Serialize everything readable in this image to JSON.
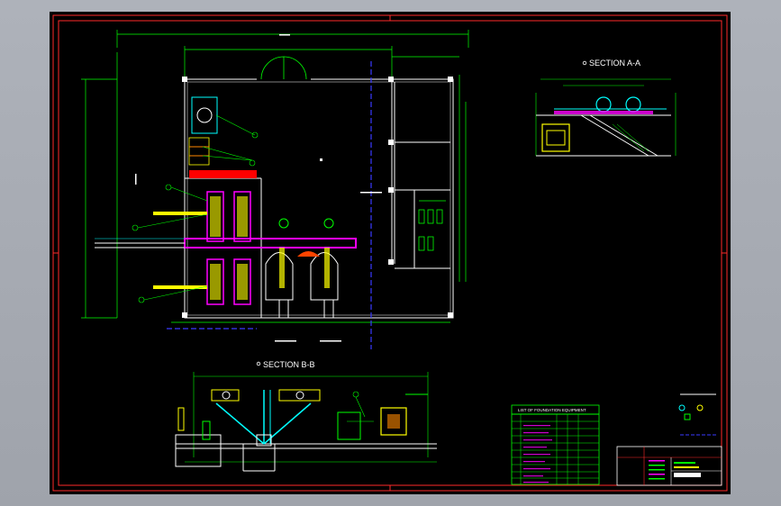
{
  "drawing": {
    "section_a_title": "SECTION A-A",
    "section_b_title": "SECTION B-B",
    "schedule_title": "LIST OF FOUNDATION EQUIPMENT",
    "colors": {
      "background": "#000000",
      "border": "#ff2a2a",
      "walls": "#ffffff",
      "dimensions": "#00ff00",
      "equipment": "#ff00ff",
      "hidden_lines": "#3a3aff",
      "cyan_detail": "#00ffff",
      "yellow_detail": "#ffff00"
    }
  }
}
